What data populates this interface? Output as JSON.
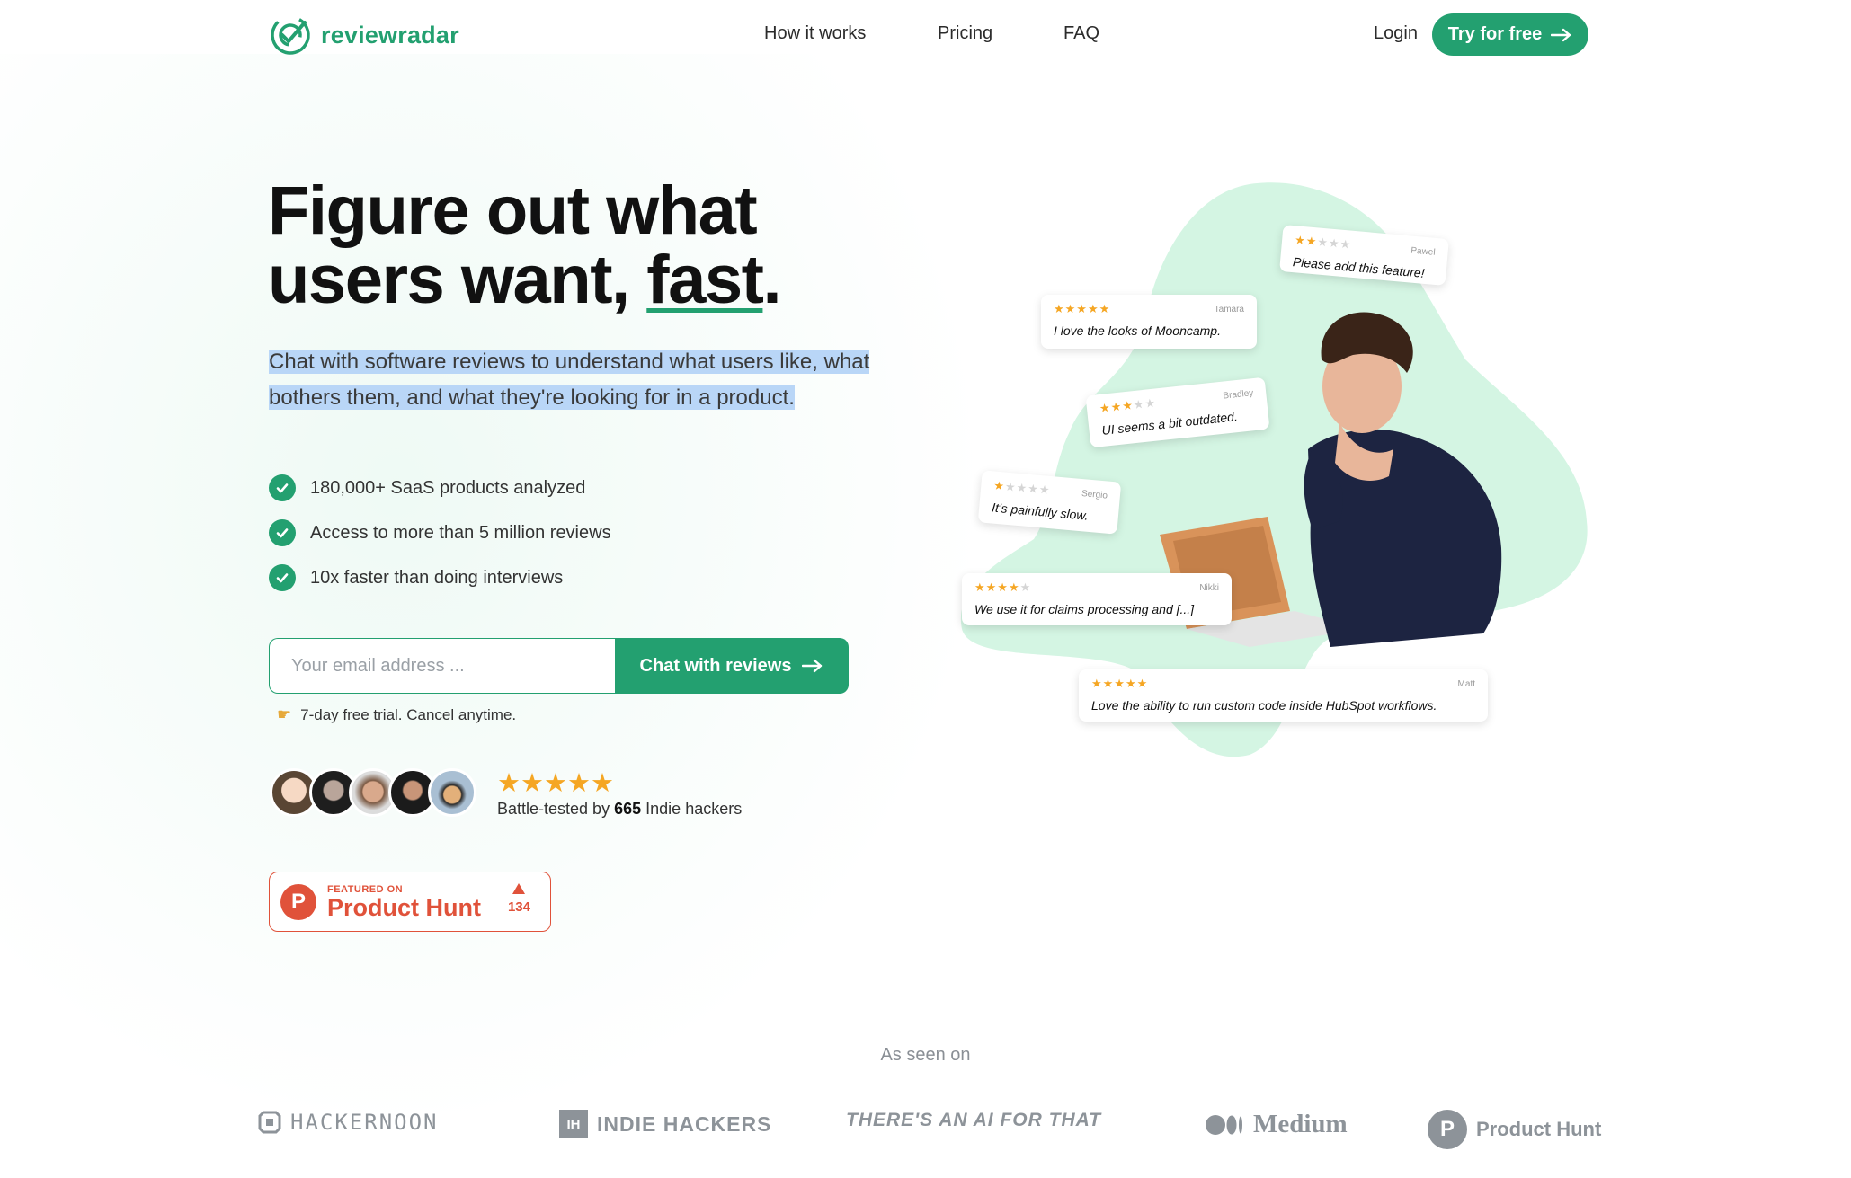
{
  "brand": {
    "name": "reviewradar",
    "accent": "#23a070"
  },
  "nav": {
    "links": [
      "How it works",
      "Pricing",
      "FAQ"
    ],
    "login": "Login",
    "cta": "Try for free"
  },
  "hero": {
    "title_line1": "Figure out what",
    "title_line2_a": "users want,",
    "title_line2_b": "fast",
    "title_line2_c": ".",
    "subtitle": "Chat with software reviews to understand what users like, what bothers them, and what they're looking for in a product.",
    "features": [
      "180,000+ SaaS products analyzed",
      "Access to more than 5 million reviews",
      "10x faster than doing interviews"
    ],
    "email_placeholder": "Your email address ...",
    "submit_label": "Chat with reviews",
    "trial_note": "7-day free trial. Cancel anytime.",
    "stars": "★★★★★",
    "social_proof_prefix": "Battle-tested by",
    "social_proof_count": "665",
    "social_proof_suffix": "Indie hackers"
  },
  "product_hunt_badge": {
    "featured": "FEATURED ON",
    "name": "Product Hunt",
    "votes": "134",
    "color": "#e0523a"
  },
  "reviews": [
    {
      "name": "Pawel",
      "rating": 2,
      "text": "Please add this feature!"
    },
    {
      "name": "Tamara",
      "rating": 5,
      "text": "I love the looks of Mooncamp."
    },
    {
      "name": "Bradley",
      "rating": 3,
      "text": "UI seems a bit outdated."
    },
    {
      "name": "Sergio",
      "rating": 1,
      "text": "It's painfully slow."
    },
    {
      "name": "Nikki",
      "rating": 4,
      "text": "We use it for claims processing and [...]"
    },
    {
      "name": "Matt",
      "rating": 5,
      "text": "Love the ability to run custom code inside HubSpot workflows."
    }
  ],
  "seen_on": {
    "title": "As seen on",
    "logos": [
      "HACKERNOON",
      "INDIE HACKERS",
      "THERE'S AN AI FOR THAT",
      "Medium",
      "Product Hunt"
    ]
  }
}
